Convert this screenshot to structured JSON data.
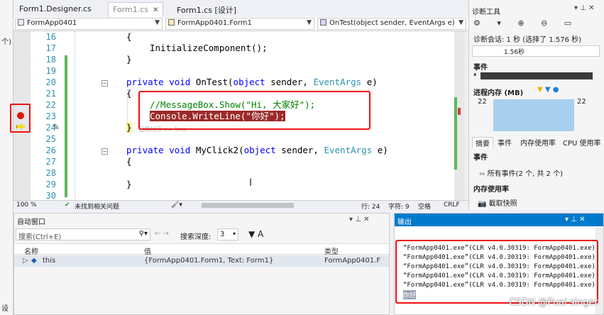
{
  "tabs": [
    {
      "label": "Form1.Designer.cs",
      "close": ""
    },
    {
      "label": "Form1.cs",
      "close": "✕"
    },
    {
      "label": "Form1.cs [设计]",
      "close": ""
    }
  ],
  "navbar": {
    "project": "FormApp0401",
    "class": "FormApp0401.Form1",
    "member": "OnTest(object sender, EventArgs e)"
  },
  "editor": {
    "line_numbers": [
      "16",
      "17",
      "18",
      "19",
      "20",
      "21",
      "22",
      "23",
      "24",
      "25",
      "26",
      "27",
      "28",
      "29",
      "30"
    ],
    "inline_hint": "已用时间 <= 1ms"
  },
  "code": {
    "l16": "{",
    "l17": "InitializeComponent();",
    "l18": "}",
    "l20_kw1": "private",
    "l20_kw2": "void",
    "l20_name": "OnTest(",
    "l20_kw3": "object",
    "l20_mid": " sender, ",
    "l20_ty": "EventArgs",
    "l20_end": " e)",
    "l21": "{",
    "l22": "//MessageBox.Show(\"Hi, 大家好\");",
    "l23": "Console.WriteLine(\"你好\");",
    "l24": "}",
    "l26_kw1": "private",
    "l26_kw2": "void",
    "l26_name": "MyClick2(",
    "l26_kw3": "object",
    "l26_mid": " sender, ",
    "l26_ty": "EventArgs",
    "l26_end": " e)",
    "l27": "{",
    "l29": "}"
  },
  "status": {
    "zoom": "100 %",
    "issues": "未找到相关问题",
    "line": "行: 24",
    "col": "字符: 9",
    "spaces": "空格",
    "eol": "CRLF"
  },
  "diagnostics": {
    "title": "诊断工具",
    "session": "诊断会话: 1 秒 (选择了 1.576 秒)",
    "timeline": "1.56秒",
    "events": "事件",
    "memory": "进程内存 (MB)",
    "mem_left": "22",
    "mem_right": "22",
    "tabs": [
      "摘要",
      "事件",
      "内存使用率",
      "CPU 使用率"
    ],
    "events_header": "事件",
    "all_events": "所有事件(2 个, 共 2 个)",
    "memory_usage": "内存使用率",
    "snapshot": "截取快照"
  },
  "autos": {
    "title": "自动窗口",
    "search_placeholder": "搜索(Ctrl+E)",
    "depth_label": "搜索深度:",
    "depth_value": "3",
    "columns": [
      "名称",
      "值",
      "类型"
    ],
    "row": {
      "name": "this",
      "value": "{FormApp0401.Form1, Text: Form1}",
      "type": "FormApp0401.F"
    }
  },
  "output": {
    "title": "输出",
    "lines": [
      "“FormApp0401.exe”(CLR v4.0.30319: FormApp0401.exe):",
      "“FormApp0401.exe”(CLR v4.0.30319: FormApp0401.exe):",
      "“FormApp0401.exe”(CLR v4.0.30319: FormApp0401.exe):",
      "“FormApp0401.exe”(CLR v4.0.30319: FormApp0401.exe):",
      "“FormApp0401.exe”(CLR v4.0.30319: FormApp0401.exe):"
    ],
    "result": "你好"
  },
  "left": {
    "b1": "个)",
    "b2": "设"
  },
  "watermark": "CSDN @Pual singer"
}
